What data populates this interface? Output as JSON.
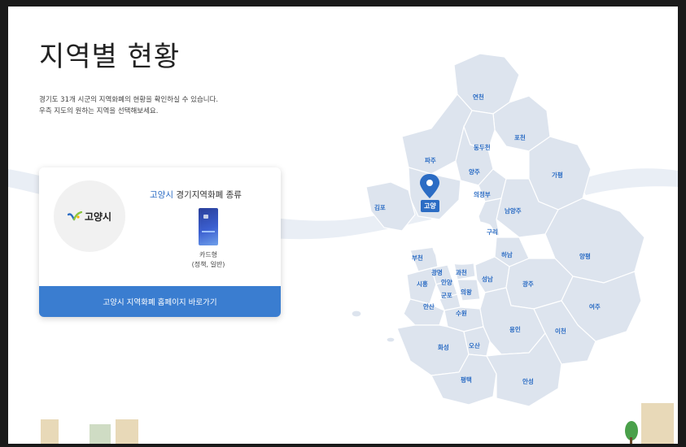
{
  "page": {
    "title": "지역별 현황",
    "description_line1": "경기도 31개 시군의 지역화폐의 현황을 확인하실 수 있습니다.",
    "description_line2": "우측 지도의 원하는 지역을 선택해보세요."
  },
  "card": {
    "logo_text": "고양시",
    "heading_city": "고양시",
    "heading_rest": " 경기지역화폐 종류",
    "type_line1": "카드형",
    "type_line2": "(정책, 일반)",
    "button_label": "고양시 지역화폐 홈페이지 바로가기"
  },
  "map": {
    "selected_region": "고양",
    "regions": [
      "연천",
      "포천",
      "동두천",
      "파주",
      "양주",
      "가평",
      "의정부",
      "김포",
      "남양주",
      "구리",
      "부천",
      "하남",
      "양평",
      "과천",
      "광명",
      "성남",
      "시흥",
      "안양",
      "의왕",
      "광주",
      "군포",
      "안산",
      "여주",
      "수원",
      "용인",
      "이천",
      "화성",
      "오산",
      "평택",
      "안성"
    ]
  },
  "colors": {
    "accent": "#2b6cc4",
    "button": "#3a7dd0",
    "map_fill": "#dde4ee",
    "map_border": "#ffffff"
  },
  "icons": {
    "map_pin": "location-pin-icon",
    "logo_mark": "goyang-logo-mark"
  }
}
